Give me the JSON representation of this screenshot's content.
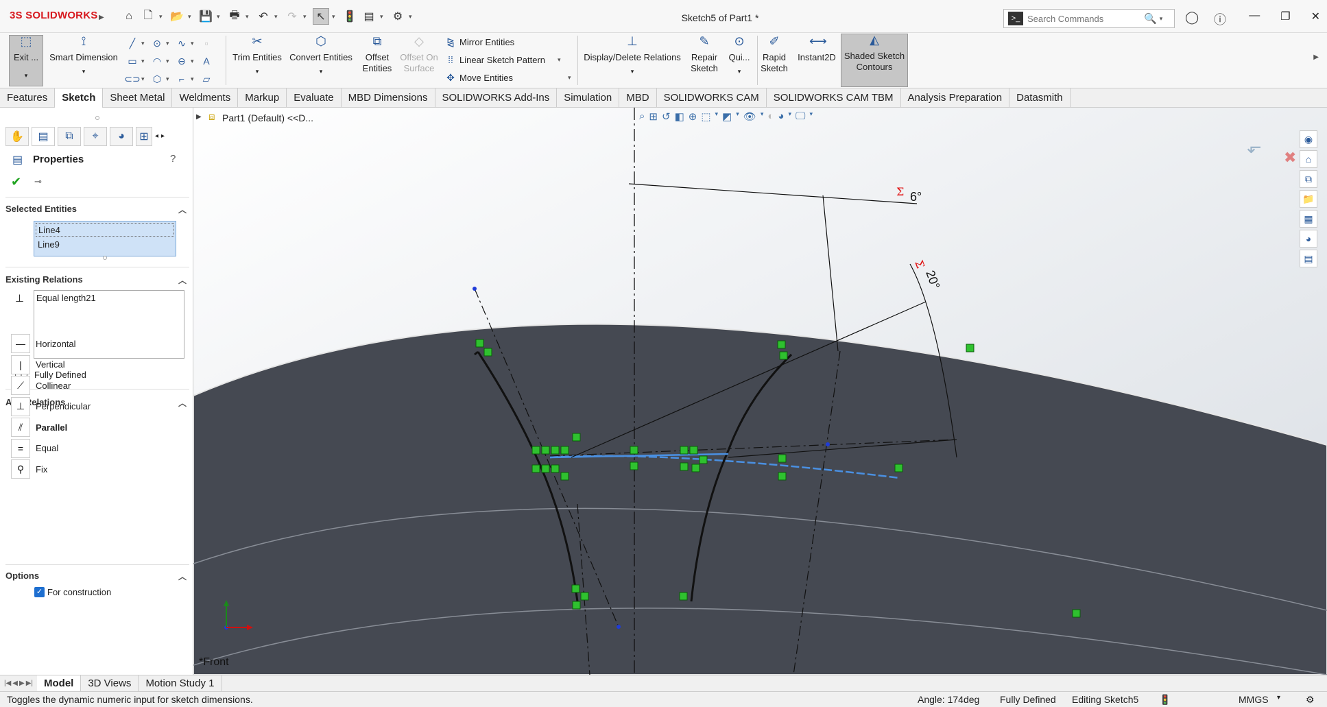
{
  "app": {
    "logo_ds": "3S",
    "logo_name": "SOLIDWORKS",
    "doc_title": "Sketch5 of Part1 *"
  },
  "search": {
    "placeholder": "Search Commands"
  },
  "commands": {
    "exit": "Exit ...",
    "smart_dimension": "Smart Dimension",
    "trim_entities": "Trim Entities",
    "convert_entities": "Convert Entities",
    "offset_entities_1": "Offset",
    "offset_entities_2": "Entities",
    "offset_on_surface_1": "Offset On",
    "offset_on_surface_2": "Surface",
    "mirror_entities": "Mirror Entities",
    "linear_sketch_pattern": "Linear Sketch Pattern",
    "move_entities": "Move Entities",
    "display_delete_relations": "Display/Delete Relations",
    "repair_sketch_1": "Repair",
    "repair_sketch_2": "Sketch",
    "quick_snaps": "Qui...",
    "rapid_sketch_1": "Rapid",
    "rapid_sketch_2": "Sketch",
    "instant2d": "Instant2D",
    "shaded_contours_1": "Shaded Sketch",
    "shaded_contours_2": "Contours"
  },
  "tabs": [
    "Features",
    "Sketch",
    "Sheet Metal",
    "Weldments",
    "Markup",
    "Evaluate",
    "MBD Dimensions",
    "SOLIDWORKS Add-Ins",
    "Simulation",
    "MBD",
    "SOLIDWORKS CAM",
    "SOLIDWORKS CAM TBM",
    "Analysis Preparation",
    "Datasmith"
  ],
  "panel": {
    "title": "Properties",
    "selected_entities_header": "Selected Entities",
    "selected_entities": [
      "Line4",
      "Line9"
    ],
    "existing_relations_header": "Existing Relations",
    "existing_relations": [
      "Equal length21"
    ],
    "status": "Fully Defined",
    "add_relations_header": "Add Relations",
    "add_relations": [
      "Horizontal",
      "Vertical",
      "Collinear",
      "Perpendicular",
      "Parallel",
      "Equal",
      "Fix"
    ],
    "options_header": "Options",
    "for_construction": "For construction"
  },
  "tree": {
    "root": "Part1 (Default) <<D..."
  },
  "viewport": {
    "view_label": "*Front",
    "dim_6": "6°",
    "dim_20": "20°"
  },
  "bottom_tabs": [
    "Model",
    "3D Views",
    "Motion Study 1"
  ],
  "status": {
    "hint": "Toggles the dynamic numeric input for sketch dimensions.",
    "angle": "Angle: 174deg",
    "state": "Fully Defined",
    "editing": "Editing Sketch5",
    "units": "MMGS"
  },
  "colors": {
    "model_face": "#454952",
    "sketch": "#111111",
    "relation": "#2fc12f",
    "selected": "#4a90e2",
    "dim_red": "#e01010"
  }
}
